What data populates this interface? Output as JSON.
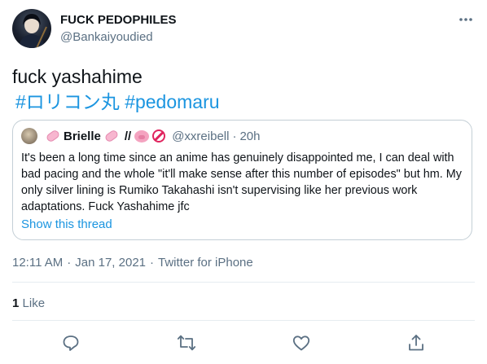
{
  "author": {
    "display_name": "FUCK PEDOPHILES",
    "handle": "@Bankaiyoudied",
    "avatar_icon": "dark-character-avatar"
  },
  "more_icon": "more-options-dots",
  "tweet": {
    "text": "fuck yashahime",
    "hashtags": [
      "#ロリコン丸",
      "#pedomaru"
    ]
  },
  "quoted_tweet": {
    "name": "Brielle",
    "separator": "//",
    "handle": "@xxreibell",
    "dot": "·",
    "time": "20h",
    "emoji_icons": [
      "pill-icon",
      "pill-icon",
      "pig-face-icon",
      "no-entry-icon"
    ],
    "body": "It's been a long time since an anime has genuinely disappointed me, I can deal with bad pacing and the whole \"it'll make sense after this number of episodes\" but hm. My only silver lining is Rumiko Takahashi isn't supervising like her previous work adaptations. Fuck Yashahime jfc",
    "show_thread": "Show this thread"
  },
  "meta": {
    "time": "12:11 AM",
    "separator": "·",
    "date": "Jan 17, 2021",
    "source": "Twitter for iPhone"
  },
  "stats": {
    "like_count": "1",
    "like_label": "Like"
  },
  "actions": [
    "reply-icon",
    "retweet-icon",
    "like-icon",
    "share-icon"
  ],
  "colors": {
    "link": "#1b95e0",
    "secondary_text": "#5b7083",
    "border": "#c4cfd6",
    "divider": "#e6ecf0"
  }
}
